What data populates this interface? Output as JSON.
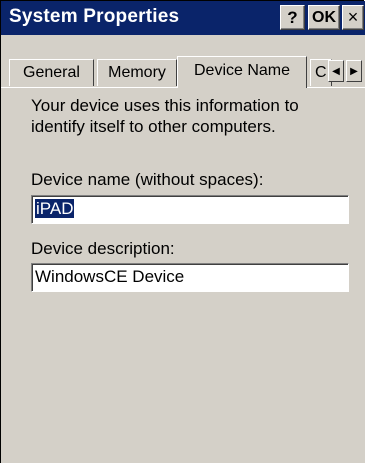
{
  "window": {
    "title": "System Properties",
    "help_label": "?",
    "ok_label": "OK",
    "close_label": "×"
  },
  "tabs": [
    {
      "label": "General",
      "selected": false
    },
    {
      "label": "Memory",
      "selected": false
    },
    {
      "label": "Device Name",
      "selected": true
    },
    {
      "label": "C",
      "selected": false
    }
  ],
  "tab_scroll": {
    "left_glyph": "◀",
    "right_glyph": "▶"
  },
  "content": {
    "intro": "Your device uses this information to identify itself to other computers.",
    "device_name_label": "Device name (without spaces):",
    "device_name_value": "iPAD",
    "device_description_label": "Device description:",
    "device_description_value": "WindowsCE Device"
  },
  "colors": {
    "titlebar": "#0a246a",
    "face": "#d4d0c8",
    "selection": "#0a246a"
  }
}
